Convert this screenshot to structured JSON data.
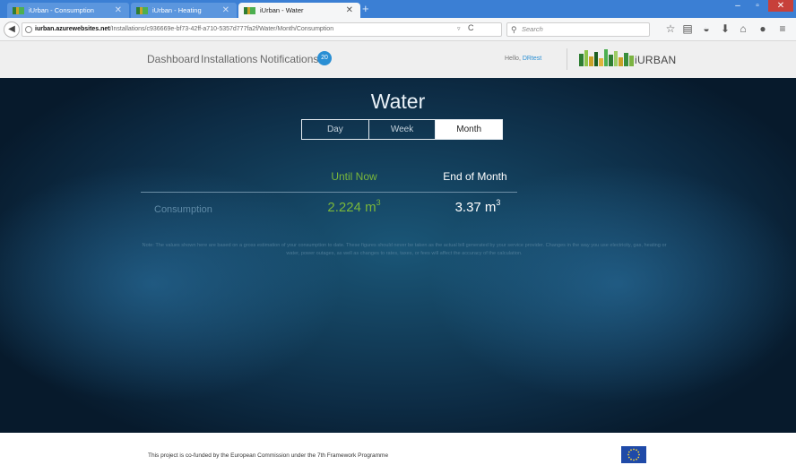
{
  "browser": {
    "tabs": [
      {
        "title": "iUrban - Consumption",
        "active": false
      },
      {
        "title": "iUrban - Heating",
        "active": false
      },
      {
        "title": "iUrban - Water",
        "active": true
      }
    ],
    "new_tab": "+",
    "url_host": "iurban.azurewebsites.net",
    "url_path": "/Installations/c936669e-bf73-42ff-a710-5357d777fa2f/Water/Month/Consumption",
    "search_placeholder": "Search",
    "toolbar_icons": [
      "star-icon",
      "reading-list-icon",
      "pocket-icon",
      "download-icon",
      "home-icon",
      "chat-icon",
      "menu-icon"
    ],
    "colors": {
      "titlebar": "#3b7fd4",
      "close": "#c7403a"
    }
  },
  "header": {
    "nav": {
      "dashboard": "Dashboard",
      "installations": "Installations",
      "notifications": "Notifications"
    },
    "notification_count": "20",
    "greeting": "Hello,",
    "username": "DRtest",
    "logo_text": "iURBAN",
    "colors": {
      "accent": "#2a8fd4"
    }
  },
  "main": {
    "title": "Water",
    "periods": [
      "Day",
      "Week",
      "Month"
    ],
    "selected_period": "Month",
    "columns": {
      "until_now": "Until Now",
      "end_of_month": "End of Month"
    },
    "row_label": "Consumption",
    "until_now_value": "2.224 m",
    "end_of_month_value": "3.37 m",
    "unit_exponent": "3",
    "disclaimer": "Note: The values shown here are based on a gross estimation of your consumption to date. These figures should never be taken as the actual bill generated by your service provider. Changes in the way you use electricity, gas, heating or water, power outages, as well as changes to rates, taxes, or fees will affect the accuracy of the calculation.",
    "colors": {
      "green": "#7ab73a",
      "white": "#ffffff"
    }
  },
  "footer": {
    "text": "This project is co-funded by the European Commission under the 7th Framework Programme"
  }
}
